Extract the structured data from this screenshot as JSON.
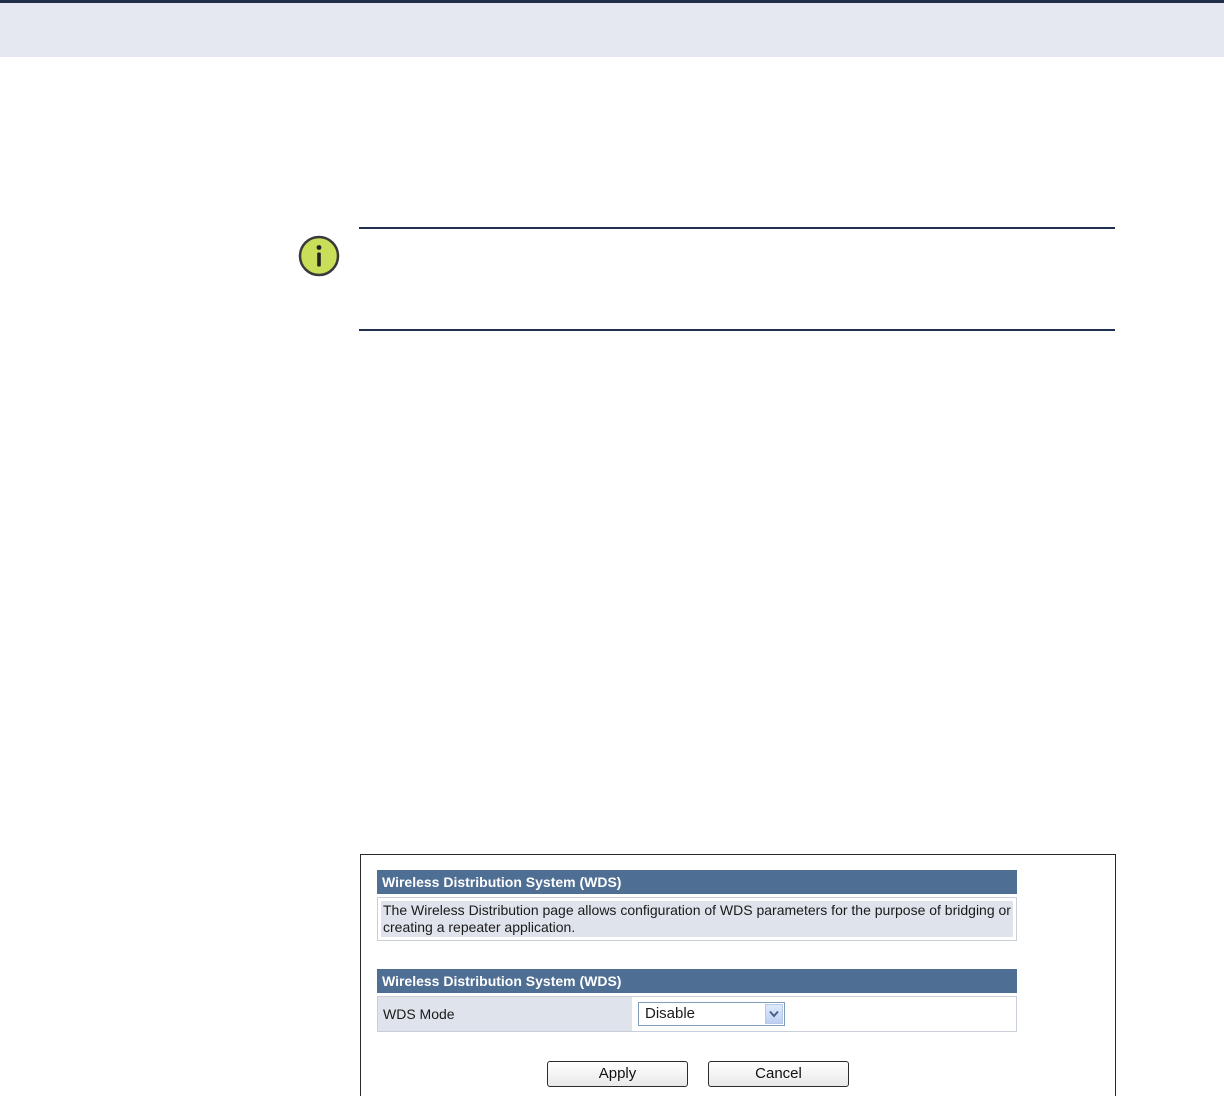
{
  "wds_panel": {
    "section_title_info": "Wireless Distribution System (WDS)",
    "description": "The Wireless Distribution page allows configuration of WDS parameters for the purpose of bridging or creating a repeater application.",
    "section_title_settings": "Wireless Distribution System (WDS)",
    "fields": {
      "wds_mode_label": "WDS Mode",
      "wds_mode_value": "Disable"
    },
    "buttons": {
      "apply": "Apply",
      "cancel": "Cancel"
    }
  },
  "icons": {
    "note": "info-icon",
    "dropdown": "chevron-down-icon"
  },
  "colors": {
    "header_band": "#e5e8f0",
    "rule": "#1f2f4c",
    "section_header": "#4f6e93",
    "label_cell": "#dfe4ec",
    "info_icon_fill": "#c9df5a"
  }
}
